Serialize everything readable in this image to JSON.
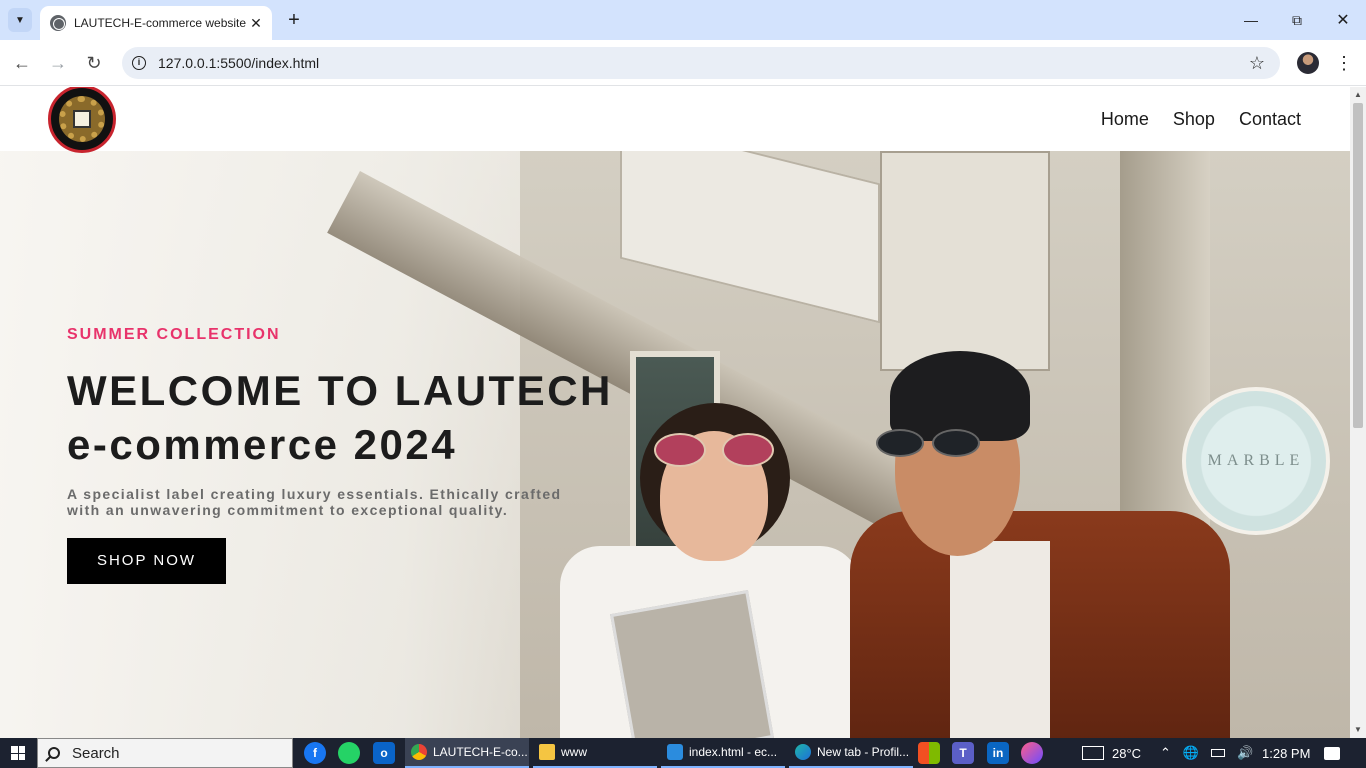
{
  "browser": {
    "tab_title": "LAUTECH-E-commerce website",
    "url": "127.0.0.1:5500/index.html"
  },
  "site": {
    "nav": [
      "Home",
      "Shop",
      "Contact"
    ]
  },
  "hero": {
    "subtitle": "SUMMER COLLECTION",
    "headline_line1": "WELCOME TO LAUTECH",
    "headline_line2": "e-commerce 2024",
    "description": "A specialist label creating luxury essentials. Ethically crafted with an unwavering commitment to exceptional quality.",
    "button": "SHOP NOW",
    "sign_text": "MARBLE"
  },
  "taskbar": {
    "search_label": "Search",
    "apps": [
      {
        "label": "LAUTECH-E-co...",
        "icon": "chrome-icon"
      },
      {
        "label": "www",
        "icon": "folder-icon"
      },
      {
        "label": "index.html - ec...",
        "icon": "vscode-icon"
      },
      {
        "label": "New tab - Profil...",
        "icon": "edge-icon"
      }
    ],
    "temperature": "28°C",
    "time": "1:28 PM"
  },
  "colors": {
    "accent_pink": "#e8336b",
    "chrome_tabstrip": "#d3e3fd",
    "taskbar": "#1c2230"
  }
}
